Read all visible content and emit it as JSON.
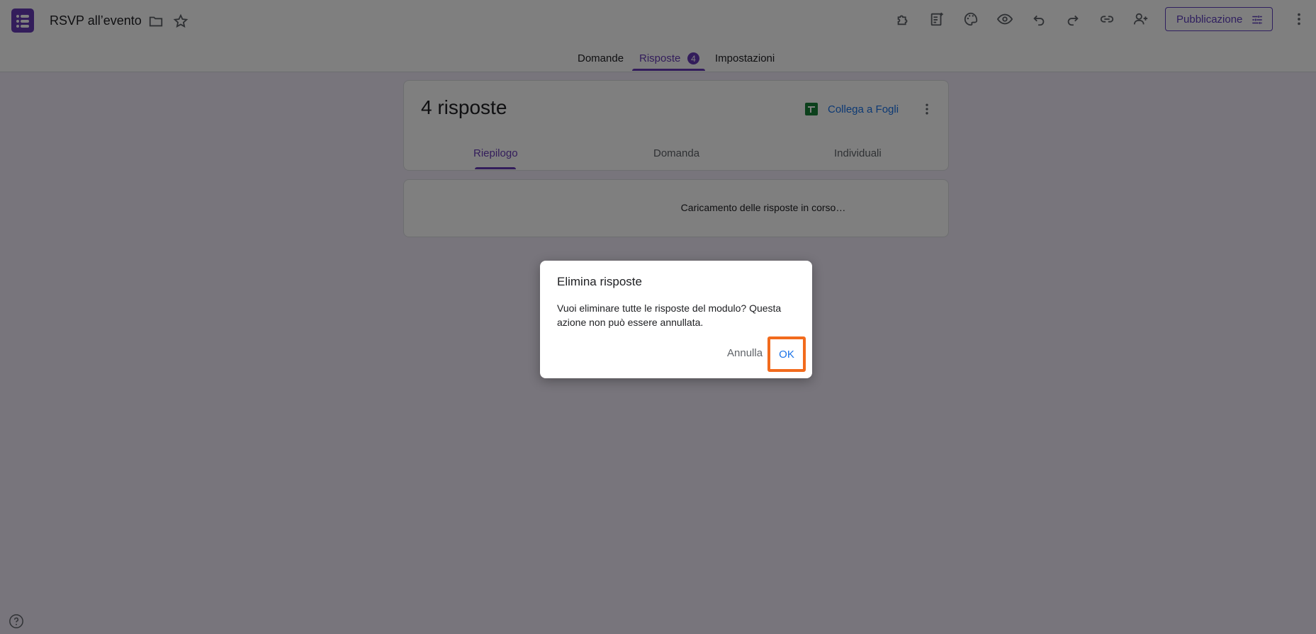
{
  "header": {
    "title": "RSVP all’evento",
    "publish_label": "Pubblicazione"
  },
  "tabs": [
    {
      "label": "Domande"
    },
    {
      "label": "Risposte",
      "badge": "4"
    },
    {
      "label": "Impostazioni"
    }
  ],
  "responses": {
    "count_label": "4 risposte",
    "link_sheets": "Collega a Fogli",
    "subtabs": [
      "Riepilogo",
      "Domanda",
      "Individuali"
    ],
    "loading_text": "Caricamento delle risposte in corso…"
  },
  "dialog": {
    "title": "Elimina risposte",
    "body": "Vuoi eliminare tutte le risposte del modulo? Questa azione non può essere annullata.",
    "cancel_label": "Annulla",
    "ok_label": "OK"
  },
  "colors": {
    "accent": "#673ab7",
    "link": "#1a73e8",
    "highlight": "#f26b1d",
    "sheets_green": "#188038"
  }
}
